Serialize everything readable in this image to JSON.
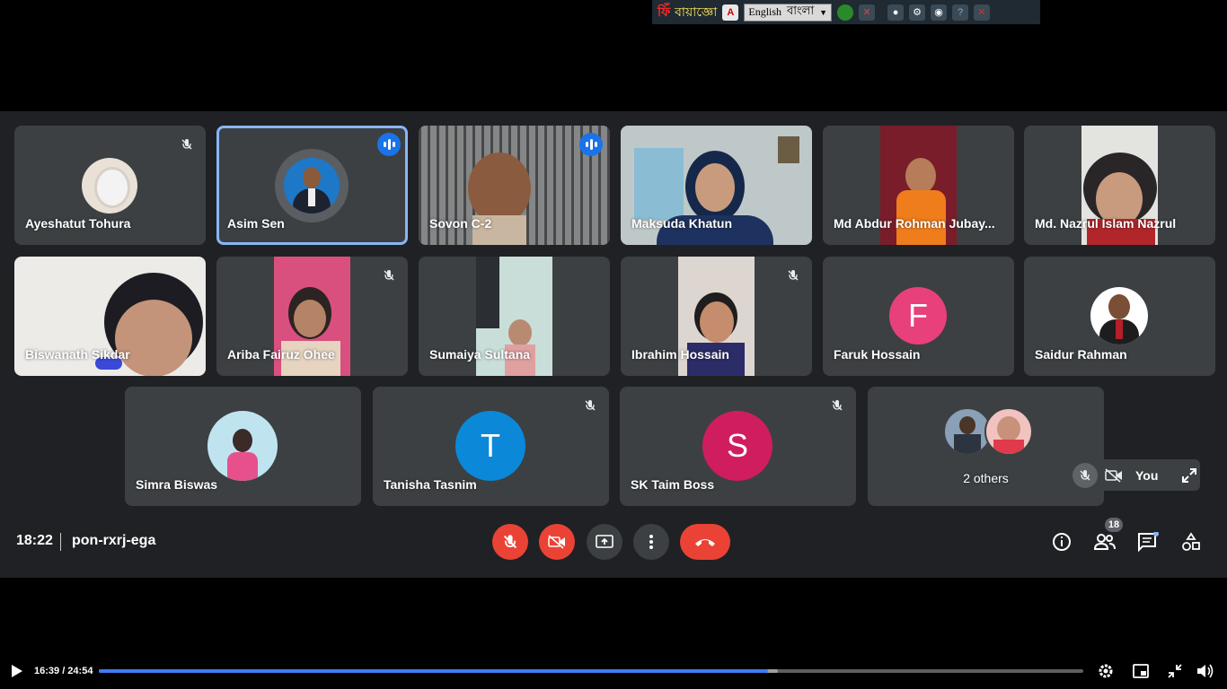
{
  "toolbar": {
    "brand_red": "ফিঁ",
    "brand_yellow": "বায়াজ্ঞো",
    "lang_english": "English",
    "lang_bangla": "বাংলা"
  },
  "participants": [
    {
      "name": "Ayeshatut Tohura"
    },
    {
      "name": "Asim Sen"
    },
    {
      "name": "Sovon C-2"
    },
    {
      "name": "Maksuda Khatun"
    },
    {
      "name": "Md Abdur Rohman Jubay..."
    },
    {
      "name": "Md. Nazrul Islam Nazrul"
    },
    {
      "name": "Biswanath Sikdar"
    },
    {
      "name": "Ariba Fairuz Ohee"
    },
    {
      "name": "Sumaiya Sultana"
    },
    {
      "name": "Ibrahim Hossain"
    },
    {
      "name": "Faruk Hossain",
      "initial": "F"
    },
    {
      "name": "Saidur Rahman"
    },
    {
      "name": "Simra Biswas"
    },
    {
      "name": "Tanisha Tasnim",
      "initial": "T"
    },
    {
      "name": "SK Taim Boss",
      "initial": "S"
    },
    {
      "name": "2 others"
    }
  ],
  "self": {
    "label": "You"
  },
  "meeting": {
    "time": "18:22",
    "code": "pon-rxrj-ega",
    "participant_count": "18"
  },
  "player": {
    "time": "16:39 / 24:54",
    "progress": 0.6793,
    "buffered": 0.69
  },
  "colors": {
    "meet_bg": "#202124",
    "tile_bg": "#3c4043",
    "red": "#ea4335",
    "blue": "#1a73e8",
    "active_outline": "#8ab4f8",
    "avatar_f": "#e8407a",
    "avatar_t": "#0b88d8",
    "avatar_s": "#d01d5f",
    "progress": "#3e7bf2"
  }
}
